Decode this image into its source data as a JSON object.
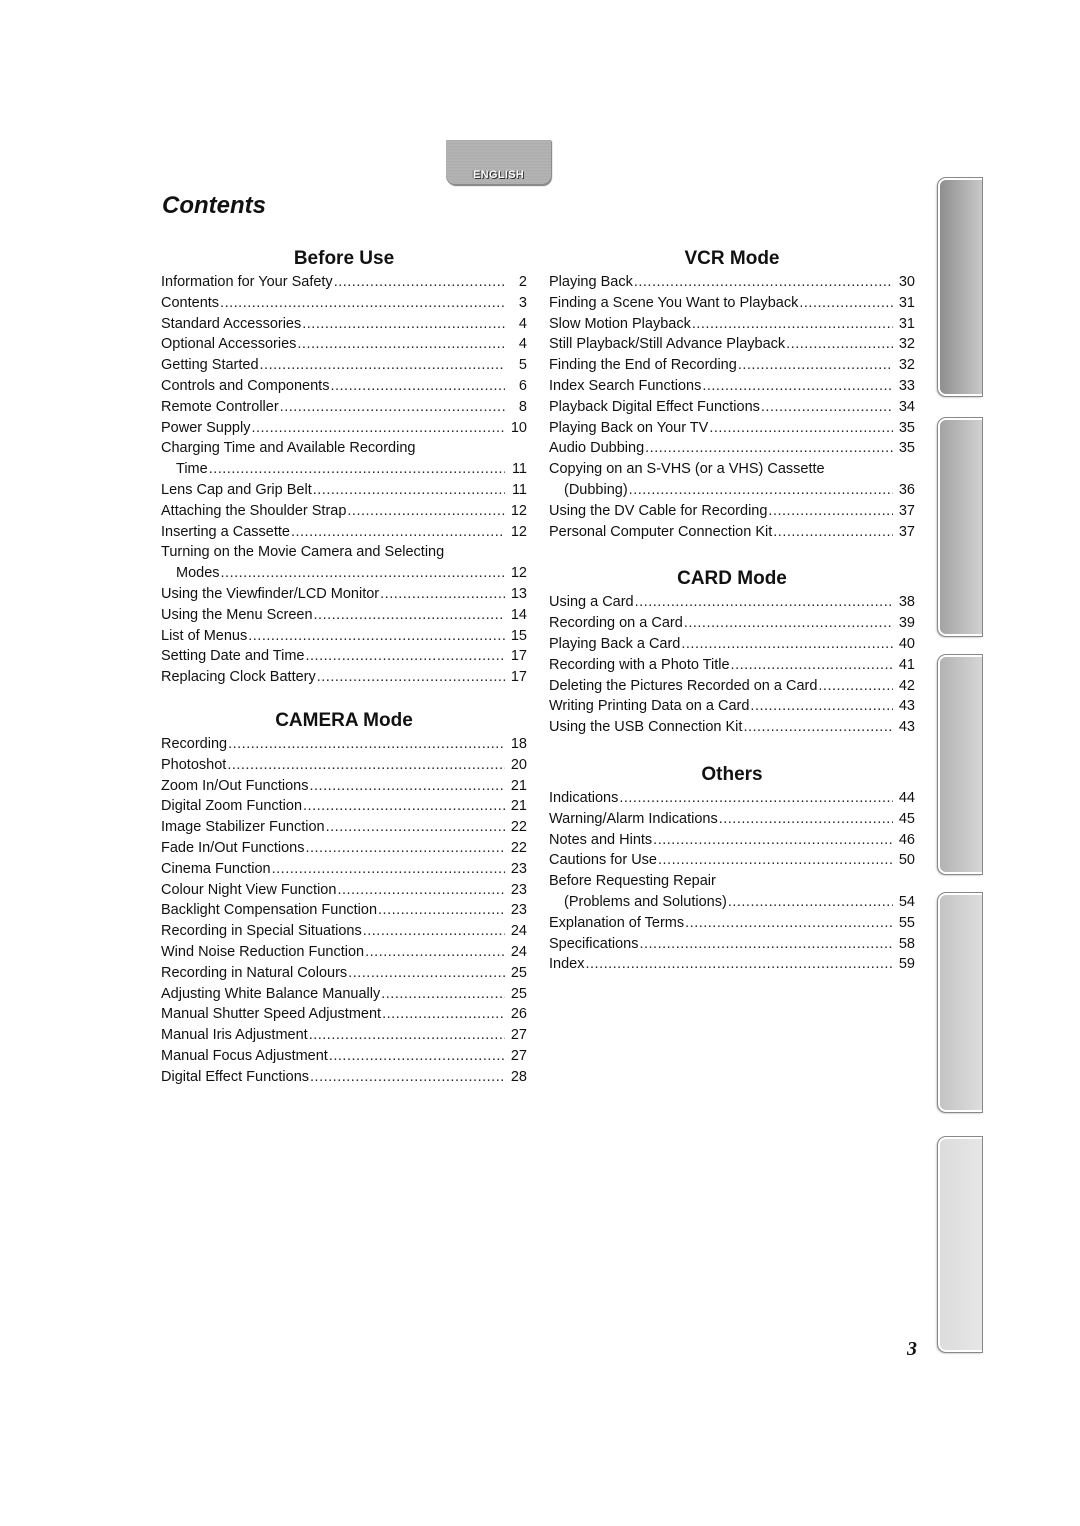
{
  "language_tab": {
    "label": "ENGLISH"
  },
  "page_title": "Contents",
  "page_number": "3",
  "columns": {
    "left": [
      {
        "heading": "Before Use",
        "entries": [
          {
            "title": "Information for Your Safety",
            "page": "2"
          },
          {
            "title": "Contents",
            "page": "3"
          },
          {
            "title": "Standard Accessories",
            "page": "4"
          },
          {
            "title": "Optional Accessories",
            "page": "4"
          },
          {
            "title": "Getting Started",
            "page": "5"
          },
          {
            "title": "Controls and Components",
            "page": "6"
          },
          {
            "title": "Remote Controller",
            "page": "8"
          },
          {
            "title": "Power Supply",
            "page": "10"
          },
          {
            "title": "Charging Time and Available Recording",
            "continuation": "Time",
            "page": "11"
          },
          {
            "title": "Lens Cap and Grip Belt",
            "page": "11"
          },
          {
            "title": "Attaching the Shoulder Strap",
            "page": "12"
          },
          {
            "title": "Inserting a Cassette",
            "page": "12"
          },
          {
            "title": "Turning on the Movie Camera and Selecting",
            "continuation": "Modes",
            "page": "12"
          },
          {
            "title": "Using the Viewfinder/LCD Monitor",
            "page": "13"
          },
          {
            "title": "Using the Menu Screen",
            "page": "14"
          },
          {
            "title": "List of Menus",
            "page": "15"
          },
          {
            "title": "Setting Date and Time",
            "page": "17"
          },
          {
            "title": "Replacing Clock Battery",
            "page": "17"
          }
        ]
      },
      {
        "heading": "CAMERA Mode",
        "entries": [
          {
            "title": "Recording",
            "page": "18"
          },
          {
            "title": "Photoshot",
            "page": "20"
          },
          {
            "title": "Zoom In/Out Functions",
            "page": "21"
          },
          {
            "title": "Digital Zoom Function",
            "page": "21"
          },
          {
            "title": "Image Stabilizer Function",
            "page": "22"
          },
          {
            "title": "Fade In/Out Functions",
            "page": "22"
          },
          {
            "title": "Cinema Function",
            "page": "23"
          },
          {
            "title": "Colour Night View Function",
            "page": "23"
          },
          {
            "title": "Backlight Compensation Function",
            "page": "23"
          },
          {
            "title": "Recording in Special Situations",
            "page": "24"
          },
          {
            "title": "Wind Noise Reduction Function",
            "page": "24"
          },
          {
            "title": "Recording in Natural Colours",
            "page": "25"
          },
          {
            "title": "Adjusting White Balance Manually",
            "page": "25"
          },
          {
            "title": "Manual Shutter Speed Adjustment",
            "page": "26"
          },
          {
            "title": "Manual Iris Adjustment",
            "page": "27"
          },
          {
            "title": "Manual Focus Adjustment",
            "page": "27"
          },
          {
            "title": "Digital Effect Functions",
            "page": "28"
          }
        ]
      }
    ],
    "right": [
      {
        "heading": "VCR Mode",
        "entries": [
          {
            "title": "Playing Back",
            "page": "30"
          },
          {
            "title": "Finding a Scene You Want to Playback",
            "page": "31"
          },
          {
            "title": "Slow Motion Playback",
            "page": "31"
          },
          {
            "title": "Still Playback/Still Advance Playback",
            "page": "32"
          },
          {
            "title": "Finding the End of Recording",
            "page": "32"
          },
          {
            "title": "Index Search Functions",
            "page": "33"
          },
          {
            "title": "Playback Digital Effect Functions",
            "page": "34"
          },
          {
            "title": "Playing Back on Your TV",
            "page": "35"
          },
          {
            "title": "Audio Dubbing",
            "page": "35"
          },
          {
            "title": "Copying on an S-VHS (or a VHS) Cassette",
            "continuation": "(Dubbing)",
            "page": "36"
          },
          {
            "title": "Using the DV Cable for Recording",
            "page": "37"
          },
          {
            "title": "Personal Computer Connection Kit",
            "page": "37"
          }
        ]
      },
      {
        "heading": "CARD Mode",
        "entries": [
          {
            "title": "Using a Card",
            "page": "38"
          },
          {
            "title": "Recording on a Card",
            "page": "39"
          },
          {
            "title": "Playing Back a Card",
            "page": "40"
          },
          {
            "title": "Recording with a Photo Title",
            "page": "41"
          },
          {
            "title": "Deleting the Pictures Recorded on a Card",
            "page": "42"
          },
          {
            "title": "Writing Printing Data on a Card",
            "page": "43"
          },
          {
            "title": "Using the USB Connection Kit",
            "page": "43"
          }
        ]
      },
      {
        "heading": "Others",
        "entries": [
          {
            "title": "Indications",
            "page": "44"
          },
          {
            "title": "Warning/Alarm Indications",
            "page": "45"
          },
          {
            "title": "Notes and Hints",
            "page": "46"
          },
          {
            "title": "Cautions for Use",
            "page": "50"
          },
          {
            "title": "Before Requesting Repair",
            "continuation": "(Problems and Solutions)",
            "page": "54"
          },
          {
            "title": "Explanation of Terms",
            "page": "55"
          },
          {
            "title": "Specifications",
            "page": "58"
          },
          {
            "title": "Index",
            "page": "59"
          }
        ]
      }
    ]
  },
  "side_tabs": [
    {
      "name": "section-tab-1",
      "color": "#8e8e8e"
    },
    {
      "name": "section-tab-2",
      "color": "#a3a3a3"
    },
    {
      "name": "section-tab-3",
      "color": "#b3b3b3"
    },
    {
      "name": "section-tab-4",
      "color": "#c4c4c4"
    },
    {
      "name": "section-tab-5",
      "color": "#dcdcdc"
    }
  ]
}
